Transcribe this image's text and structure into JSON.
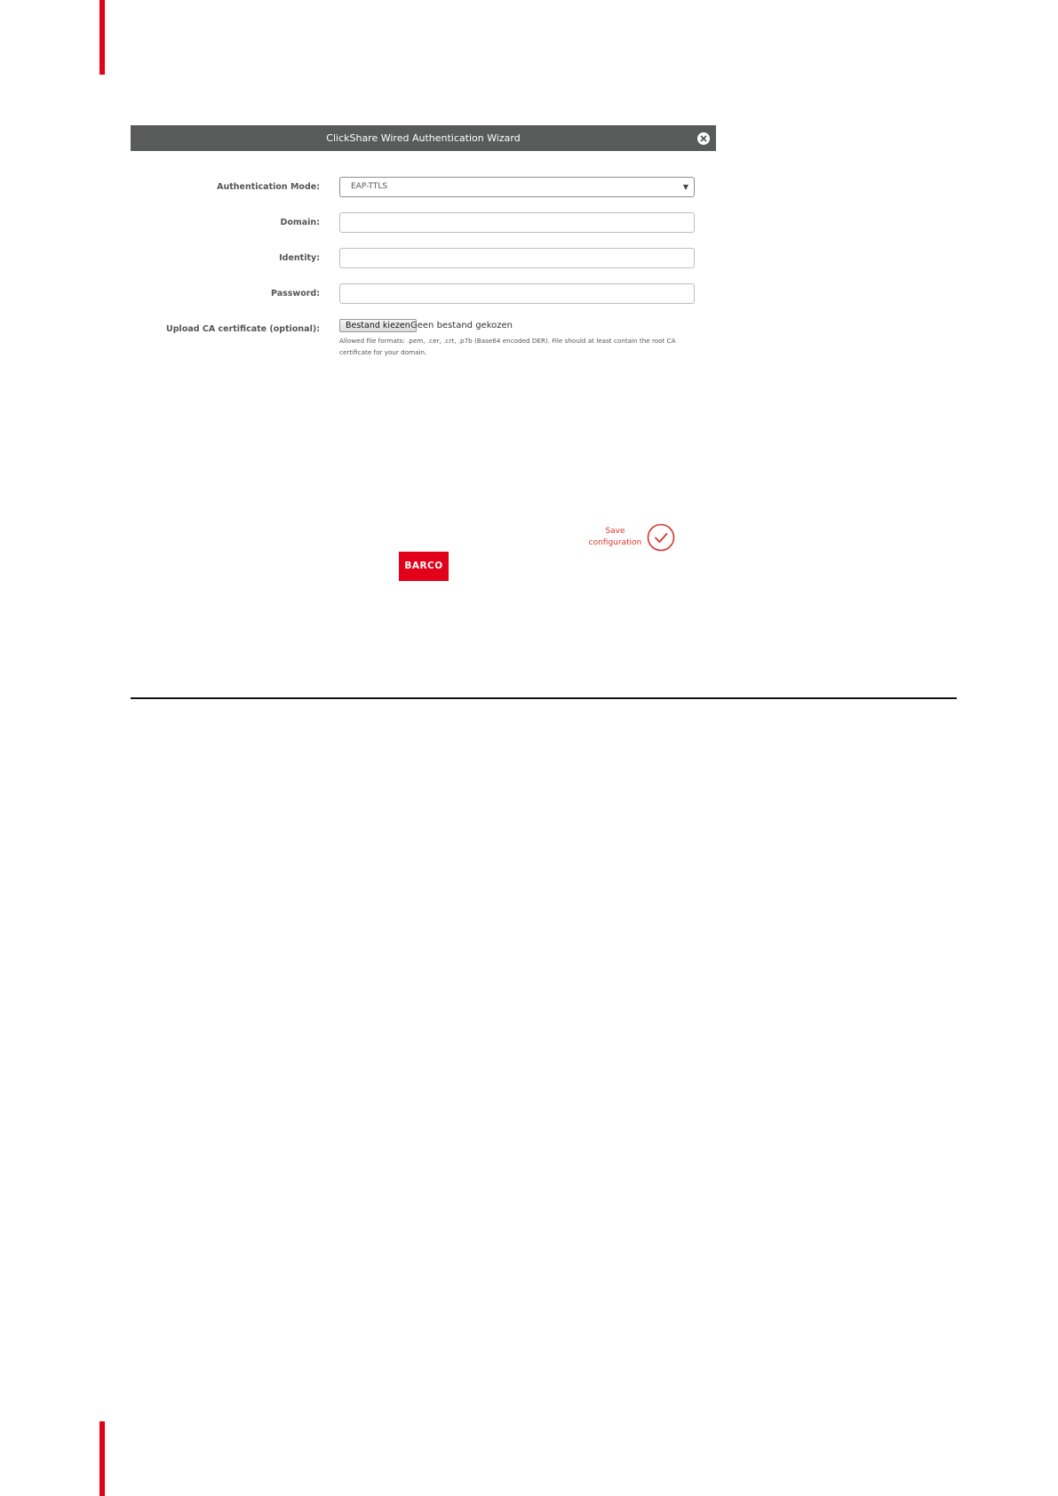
{
  "wizard": {
    "title": "ClickShare Wired Authentication Wizard"
  },
  "form": {
    "auth_mode_label": "Authentication Mode:",
    "auth_mode_value": "EAP-TTLS",
    "domain_label": "Domain:",
    "domain_value": "",
    "identity_label": "Identity:",
    "identity_value": "",
    "password_label": "Password:",
    "password_value": "",
    "upload_label": "Upload CA certificate (optional):",
    "file_button_label": "Bestand kiezen",
    "file_status": "Geen bestand gekozen",
    "help_text": "Allowed file formats: .pem, .cer, .crt, .p7b (Base64 encoded DER). File should at least contain the root CA certificate for your domain."
  },
  "actions": {
    "save_label_line1": "Save",
    "save_label_line2": "configuration"
  },
  "brand": {
    "logo_text": "BARCO",
    "accent_color": "#e2001a",
    "header_color": "#595b5b"
  },
  "icons": {
    "close": "close-icon",
    "save": "check-circle-icon",
    "dropdown": "chevron-down-icon"
  }
}
